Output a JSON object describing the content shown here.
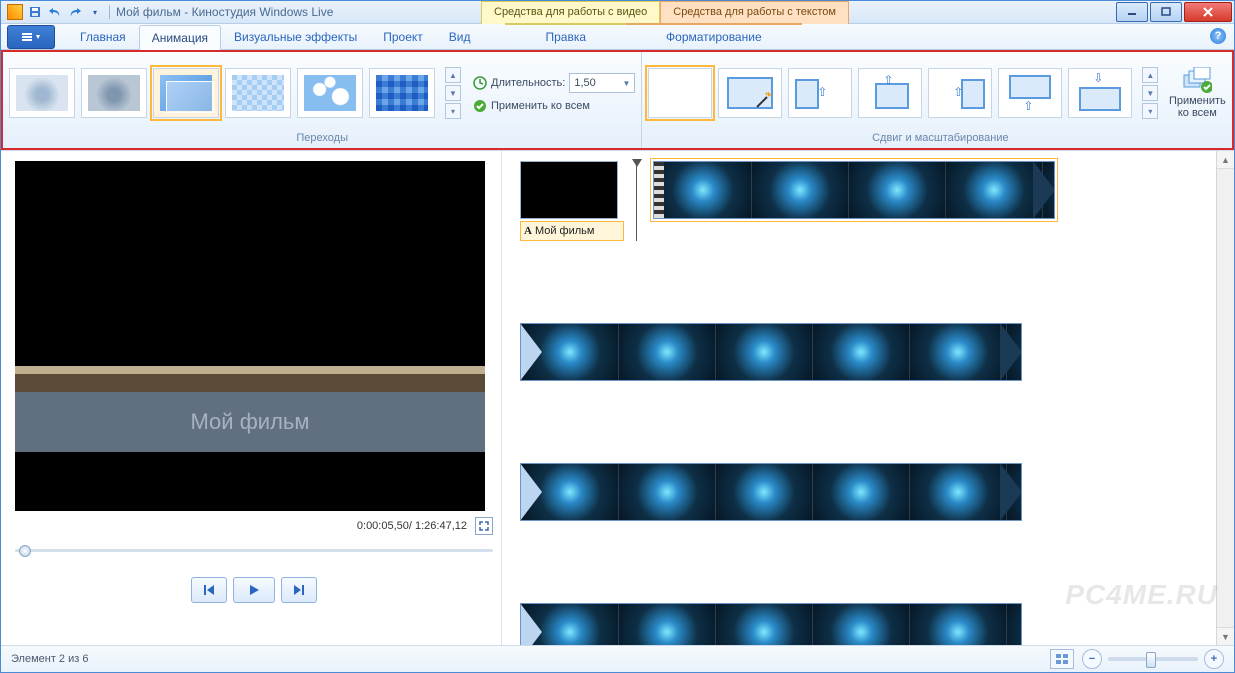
{
  "titlebar": {
    "document": "Мой фильм",
    "app": "Киностудия Windows Live",
    "full": "Мой фильм - Киностудия Windows Live",
    "context_video": "Средства для работы с видео",
    "context_text": "Средства для работы с текстом"
  },
  "ribbon": {
    "tabs": {
      "home": "Главная",
      "animation": "Анимация",
      "visual_effects": "Визуальные эффекты",
      "project": "Проект",
      "view": "Вид",
      "edit": "Правка",
      "format": "Форматирование"
    },
    "active_tab": "animation",
    "groups": {
      "transitions": "Переходы",
      "pan_zoom": "Сдвиг и масштабирование"
    },
    "duration_label": "Длительность:",
    "duration_value": "1,50",
    "apply_all": "Применить ко всем",
    "apply_all_stacked": "Применить\nко всем"
  },
  "preview": {
    "overlay_title": "Мой фильм",
    "current_time": "0:00:05,50",
    "total_time": "1:26:47,12",
    "time_display": "0:00:05,50/ 1:26:47,12"
  },
  "timeline": {
    "title_clip_caption": "Мой фильм"
  },
  "status": {
    "text": "Элемент 2 из 6"
  },
  "watermark": "PC4ME.RU"
}
